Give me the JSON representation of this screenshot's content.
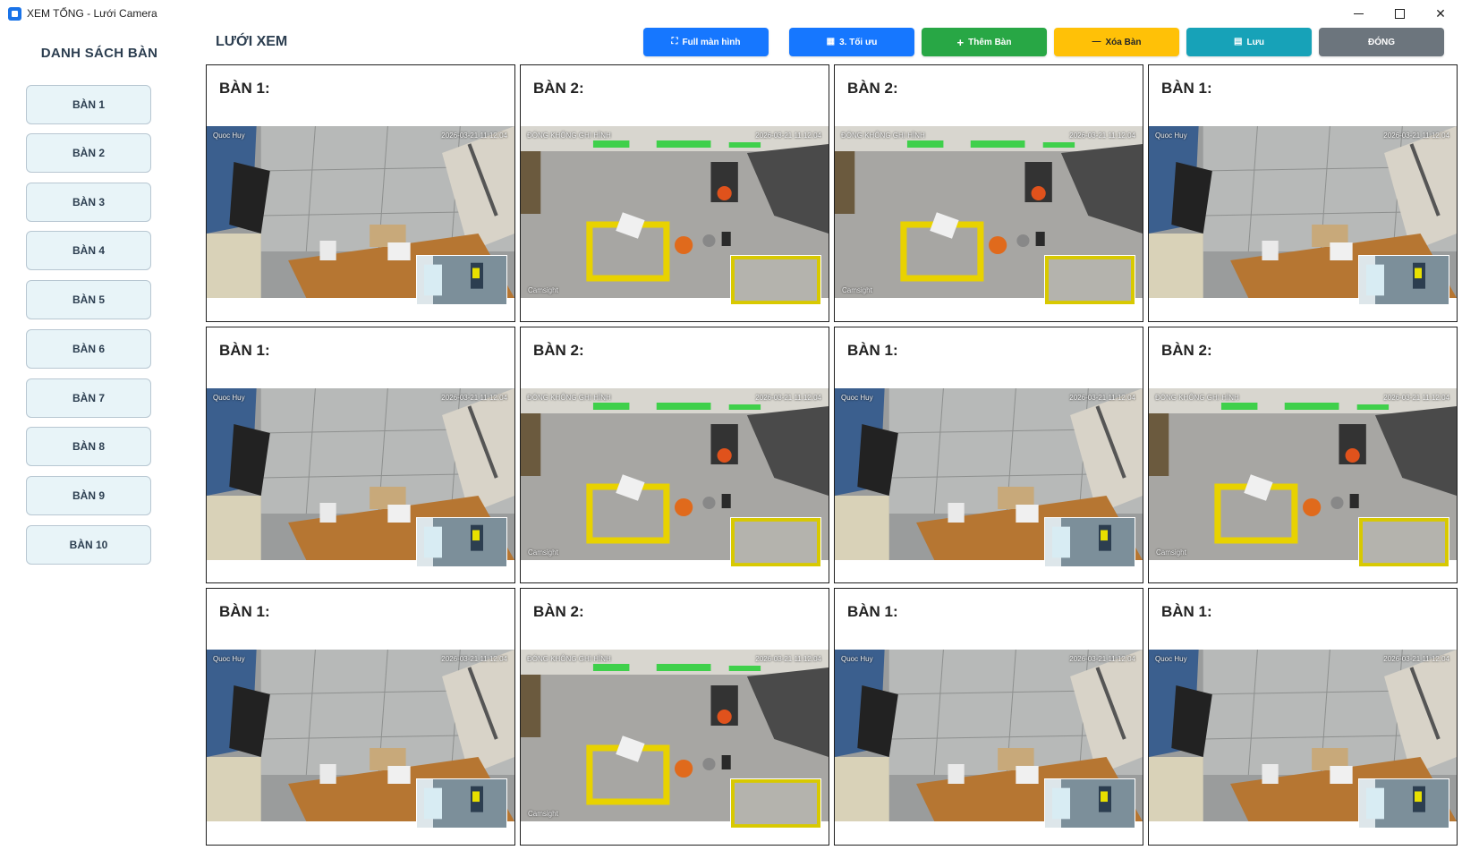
{
  "window": {
    "title": "XEM TỔNG - Lưới Camera",
    "minimize": "—",
    "maximize": "☐",
    "close": "✕"
  },
  "sidebar": {
    "title": "DANH SÁCH BÀN",
    "items": [
      {
        "label": "BÀN 1"
      },
      {
        "label": "BÀN 2"
      },
      {
        "label": "BÀN 3"
      },
      {
        "label": "BÀN 4"
      },
      {
        "label": "BÀN 5"
      },
      {
        "label": "BÀN 6"
      },
      {
        "label": "BÀN 7"
      },
      {
        "label": "BÀN 8"
      },
      {
        "label": "BÀN 9"
      },
      {
        "label": "BÀN 10"
      }
    ]
  },
  "header": {
    "title": "LƯỚI XEM",
    "buttons": {
      "fullscreen": {
        "icon": "⛶",
        "label": "Full màn hình"
      },
      "optimize": {
        "icon": "▦",
        "label": "3. Tối ưu"
      },
      "add": {
        "icon": "+",
        "label": "Thêm Bàn"
      },
      "remove": {
        "icon": "—",
        "label": "Xóa Bàn"
      },
      "save": {
        "icon": "▤",
        "label": "Lưu"
      },
      "close": {
        "label": "ĐÓNG"
      }
    }
  },
  "grid": {
    "cells": [
      {
        "label": "BÀN 1:",
        "cam": "A",
        "overlay_left": "Quoc Huy",
        "overlay_right": "2026-03-21 11:12:04",
        "overlay_bottom": ""
      },
      {
        "label": "BÀN 2:",
        "cam": "B",
        "overlay_left": "ĐÓNG KHÔNG GHI HÌNH",
        "overlay_right": "2026-03-21 11:12:04",
        "overlay_bottom": "Camsight"
      },
      {
        "label": "BÀN 2:",
        "cam": "B",
        "overlay_left": "ĐÓNG KHÔNG GHI HÌNH",
        "overlay_right": "2026-03-21 11:12:04",
        "overlay_bottom": "Camsight"
      },
      {
        "label": "BÀN 1:",
        "cam": "A",
        "overlay_left": "Quoc Huy",
        "overlay_right": "2026-03-21 11:12:04",
        "overlay_bottom": ""
      },
      {
        "label": "BÀN 1:",
        "cam": "A",
        "overlay_left": "Quoc Huy",
        "overlay_right": "2026-03-21 11:12:04",
        "overlay_bottom": ""
      },
      {
        "label": "BÀN 2:",
        "cam": "B",
        "overlay_left": "ĐÓNG KHÔNG GHI HÌNH",
        "overlay_right": "2026-03-21 11:12:04",
        "overlay_bottom": "Camsight"
      },
      {
        "label": "BÀN 1:",
        "cam": "A",
        "overlay_left": "Quoc Huy",
        "overlay_right": "2026-03-21 11:12:04",
        "overlay_bottom": ""
      },
      {
        "label": "BÀN 2:",
        "cam": "B",
        "overlay_left": "ĐÓNG KHÔNG GHI HÌNH",
        "overlay_right": "2026-03-21 11:12:04",
        "overlay_bottom": "Camsight"
      },
      {
        "label": "BÀN 1:",
        "cam": "A",
        "overlay_left": "Quoc Huy",
        "overlay_right": "2026-03-21 11:12:04",
        "overlay_bottom": ""
      },
      {
        "label": "BÀN 2:",
        "cam": "B",
        "overlay_left": "ĐÓNG KHÔNG GHI HÌNH",
        "overlay_right": "2026-03-21 11:12:04",
        "overlay_bottom": "Camsight"
      },
      {
        "label": "BÀN 1:",
        "cam": "A",
        "overlay_left": "Quoc Huy",
        "overlay_right": "2026-03-21 11:12:04",
        "overlay_bottom": ""
      },
      {
        "label": "BÀN 1:",
        "cam": "A",
        "overlay_left": "Quoc Huy",
        "overlay_right": "2026-03-21 11:12:04",
        "overlay_bottom": ""
      }
    ]
  },
  "colors": {
    "primary": "#1677ff",
    "success": "#28a745",
    "warning": "#ffc107",
    "info": "#17a2b8",
    "secondary": "#6c757d",
    "sidebar_item_bg": "#e8f4f8"
  }
}
